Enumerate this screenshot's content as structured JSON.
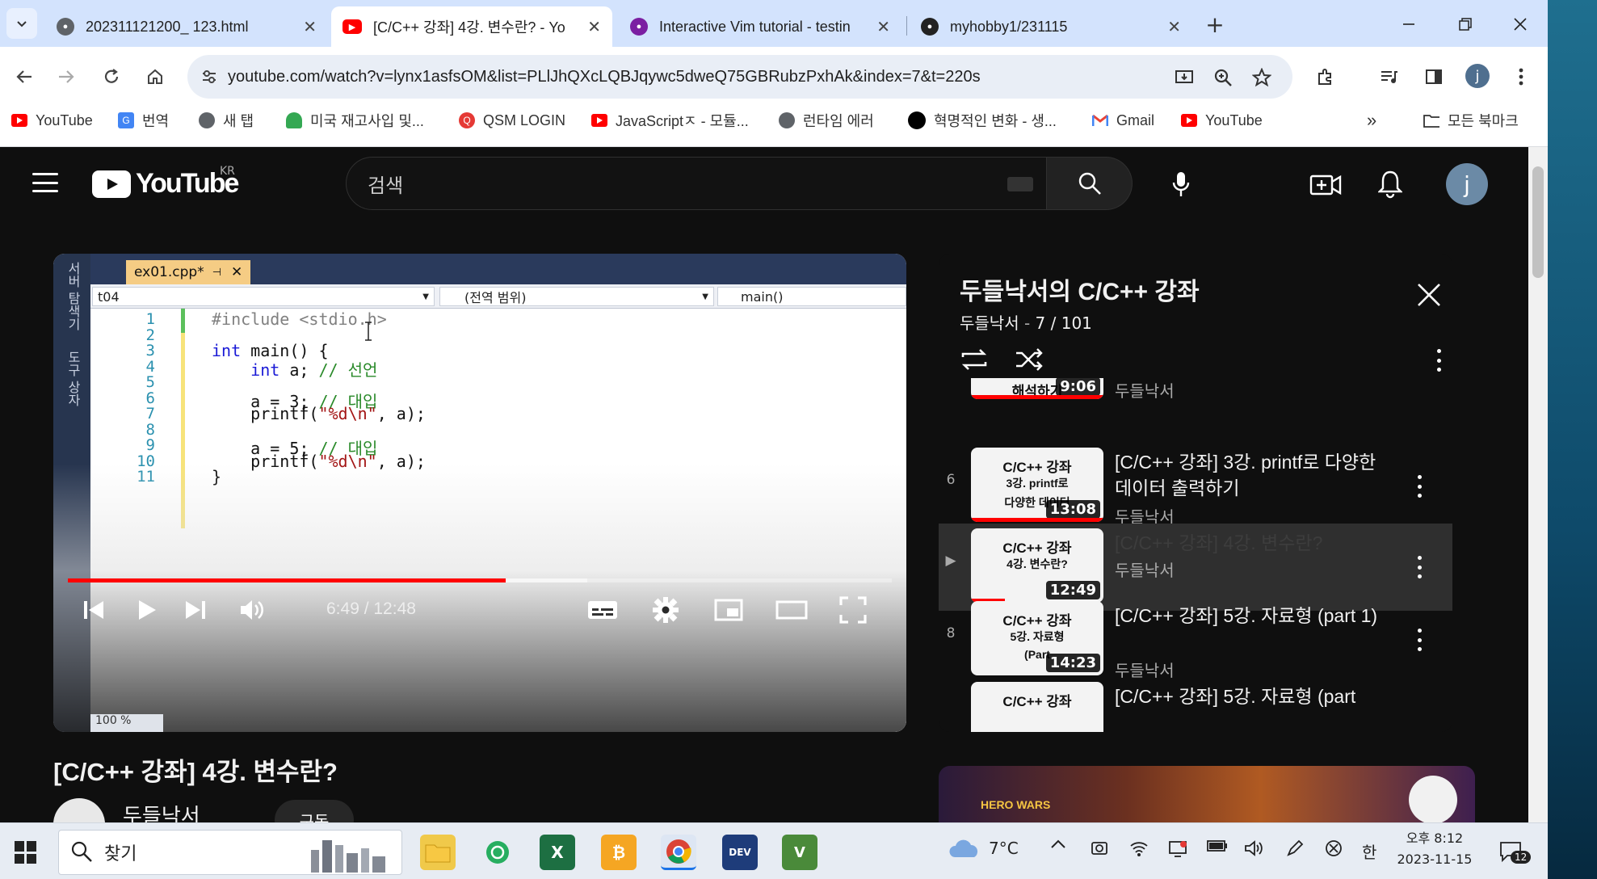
{
  "browser": {
    "tabs": [
      {
        "title": "202311121200_ 123.html",
        "active": false
      },
      {
        "title": "[C/C++ 강좌] 4강. 변수란? - Yo",
        "active": true
      },
      {
        "title": "Interactive Vim tutorial - testin",
        "active": false
      },
      {
        "title": "myhobby1/231115",
        "active": false
      }
    ],
    "url": "youtube.com/watch?v=lynx1asfsOM&list=PLlJhQXcLQBJqywc5dweQ75GBRubzPxhAk&index=7&t=220s",
    "profile_initial": "j",
    "bookmarks": [
      {
        "label": "YouTube",
        "icon": "youtube-icon",
        "color": "#ff0000"
      },
      {
        "label": "번역",
        "icon": "translate-icon",
        "color": "#4285f4"
      },
      {
        "label": "새 탭",
        "icon": "globe-icon",
        "color": "#5f6368"
      },
      {
        "label": "미국 재고사입 및...",
        "icon": "leaf-icon",
        "color": "#34a853"
      },
      {
        "label": "QSM LOGIN",
        "icon": "q-icon",
        "color": "#e53935"
      },
      {
        "label": "JavaScriptㅈ - 모듈...",
        "icon": "youtube-icon",
        "color": "#ff0000"
      },
      {
        "label": "런타임 에러",
        "icon": "globe-icon",
        "color": "#5f6368"
      },
      {
        "label": "혁명적인 변화 - 생...",
        "icon": "circle-icon",
        "color": "#000000"
      },
      {
        "label": "Gmail",
        "icon": "gmail-icon",
        "color": "#ea4335"
      },
      {
        "label": "YouTube",
        "icon": "youtube-icon",
        "color": "#ff0000"
      }
    ],
    "all_bookmarks": "모든 북마크",
    "more_bookmarks": "»"
  },
  "youtube": {
    "logo_region": "KR",
    "search_placeholder": "검색",
    "avatar_initial": "j",
    "video": {
      "title": "[C/C++ 강좌] 4강. 변수란?",
      "channel": "두들낙서",
      "subscribe_label": "구독",
      "time": "6:49 / 12:48",
      "played_fraction": 0.531,
      "loaded_fraction": 0.63,
      "ide": {
        "file_tab": "ex01.cpp*",
        "nav_project": "t04",
        "nav_scope": "(전역 범위)",
        "nav_func": "main()",
        "side_labels": [
          "서버 탐색기",
          "도구 상자"
        ],
        "zoom": "100 %",
        "lines": [
          {
            "n": "1",
            "code": "#include <stdio.h>"
          },
          {
            "n": "2",
            "code": ""
          },
          {
            "n": "3",
            "code": "int main() {"
          },
          {
            "n": "4",
            "code": "    int a; // 선언"
          },
          {
            "n": "5",
            "code": ""
          },
          {
            "n": "6",
            "code": "    a = 3; // 대입"
          },
          {
            "n": "7",
            "code": "    printf(\"%d\\n\", a);"
          },
          {
            "n": "8",
            "code": ""
          },
          {
            "n": "9",
            "code": "    a = 5; // 대입"
          },
          {
            "n": "10",
            "code": "    printf(\"%d\\n\", a);"
          },
          {
            "n": "11",
            "code": "}"
          }
        ]
      }
    },
    "playlist": {
      "title": "두들낙서의 C/C++ 강좌",
      "owner": "두들낙서",
      "position": "7 / 101",
      "items": [
        {
          "index": "",
          "thumb_lines": [
            "해석하기"
          ],
          "duration": "9:06",
          "title": "",
          "channel": "두들낙서",
          "current": false
        },
        {
          "index": "6",
          "thumb_lines": [
            "C/C++ 강좌",
            "3강. printf로",
            "다양한 데이터"
          ],
          "duration": "13:08",
          "title": "[C/C++ 강좌] 3강. printf로 다양한 데이터 출력하기",
          "channel": "두들낙서",
          "current": false
        },
        {
          "index": "▶",
          "thumb_lines": [
            "C/C++ 강좌",
            "4강. 변수란?"
          ],
          "duration": "12:49",
          "title": "[C/C++ 강좌] 4강. 변수란?",
          "channel": "두들낙서",
          "current": true
        },
        {
          "index": "8",
          "thumb_lines": [
            "C/C++ 강좌",
            "5강. 자료형",
            "(Part"
          ],
          "duration": "14:23",
          "title": "[C/C++ 강좌] 5강. 자료형 (part 1)",
          "channel": "두들낙서",
          "current": false
        },
        {
          "index": "",
          "thumb_lines": [
            "C/C++ 강좌"
          ],
          "duration": "",
          "title": "[C/C++ 강좌] 5강. 자료형 (part",
          "channel": "",
          "current": false
        }
      ]
    },
    "ad_logo": "HERO WARS"
  },
  "taskbar": {
    "search_placeholder": "찾기",
    "weather": "7°C",
    "ime": "한",
    "time": "오후 8:12",
    "date": "2023-11-15",
    "notification_count": "12"
  }
}
